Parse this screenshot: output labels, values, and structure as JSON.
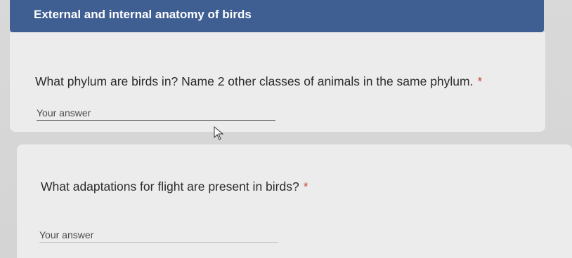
{
  "form": {
    "section_title": "External and internal anatomy of birds",
    "questions": [
      {
        "text": "What phylum are birds in? Name 2 other classes of animals in the same phylum.",
        "required_marker": "*",
        "placeholder": "Your answer"
      },
      {
        "text": "What adaptations for flight are present in birds?",
        "required_marker": "*",
        "placeholder": "Your answer"
      }
    ]
  },
  "colors": {
    "header": "#3f5f93",
    "required": "#c9493a"
  },
  "icons": {
    "cursor": "mouse-pointer-icon"
  }
}
